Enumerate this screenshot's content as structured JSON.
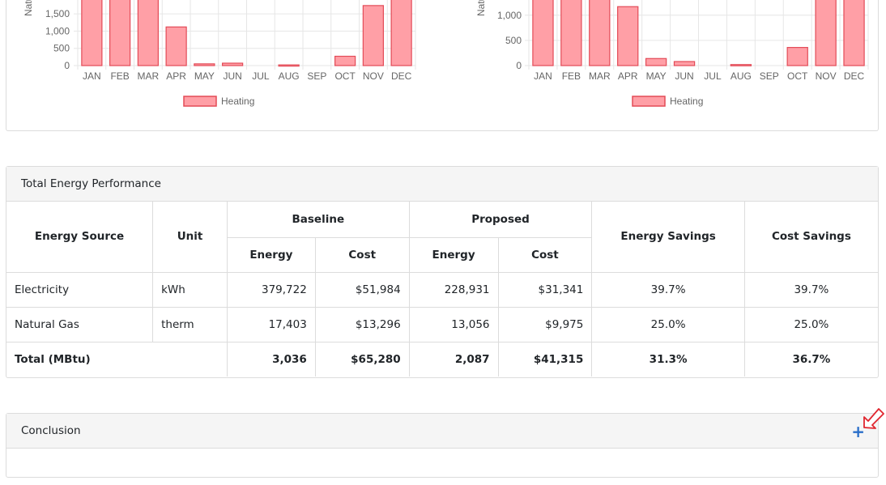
{
  "charts": [
    {
      "ylabel": "Natu",
      "yticks": [
        "1,500",
        "1,000",
        "500",
        "0"
      ],
      "months": [
        "JAN",
        "FEB",
        "MAR",
        "APR",
        "MAY",
        "JUN",
        "JUL",
        "AUG",
        "SEP",
        "OCT",
        "NOV",
        "DEC"
      ],
      "legend": "Heating",
      "colors": {
        "fill": "#ff9fa6",
        "stroke": "#e34b57",
        "grid": "#e6e6e6",
        "text": "#666666"
      }
    },
    {
      "ylabel": "Natu",
      "yticks": [
        "1,000",
        "500",
        "0"
      ],
      "months": [
        "JAN",
        "FEB",
        "MAR",
        "APR",
        "MAY",
        "JUN",
        "JUL",
        "AUG",
        "SEP",
        "OCT",
        "NOV",
        "DEC"
      ],
      "legend": "Heating",
      "colors": {
        "fill": "#ff9fa6",
        "stroke": "#e34b57",
        "grid": "#e6e6e6",
        "text": "#666666"
      }
    }
  ],
  "chart_data": [
    {
      "type": "bar",
      "categories": [
        "JAN",
        "FEB",
        "MAR",
        "APR",
        "MAY",
        "JUN",
        "JUL",
        "AUG",
        "SEP",
        "OCT",
        "NOV",
        "DEC"
      ],
      "series": [
        {
          "name": "Heating",
          "values": [
            2400,
            2300,
            2200,
            1120,
            50,
            70,
            0,
            20,
            0,
            270,
            1740,
            2500
          ]
        }
      ],
      "ylabel": "Natu",
      "yticks": [
        0,
        500,
        1000,
        1500
      ],
      "ylim": [
        0,
        2000
      ],
      "grid": true,
      "legend": "bottom"
    },
    {
      "type": "bar",
      "categories": [
        "JAN",
        "FEB",
        "MAR",
        "APR",
        "MAY",
        "JUN",
        "JUL",
        "AUG",
        "SEP",
        "OCT",
        "NOV",
        "DEC"
      ],
      "series": [
        {
          "name": "Heating",
          "values": [
            1700,
            1650,
            1600,
            1170,
            140,
            80,
            0,
            20,
            0,
            360,
            1500,
            1750
          ]
        }
      ],
      "ylabel": "Natu",
      "yticks": [
        0,
        500,
        1000
      ],
      "ylim": [
        0,
        1200
      ],
      "grid": true,
      "legend": "bottom"
    }
  ],
  "performance": {
    "title": "Total Energy Performance",
    "headers": {
      "source": "Energy Source",
      "unit": "Unit",
      "baseline": "Baseline",
      "proposed": "Proposed",
      "energy": "Energy",
      "cost": "Cost",
      "energy_savings": "Energy Savings",
      "cost_savings": "Cost Savings"
    },
    "rows": [
      {
        "source": "Electricity",
        "unit": "kWh",
        "b_energy": "379,722",
        "b_cost": "$51,984",
        "p_energy": "228,931",
        "p_cost": "$31,341",
        "e_sav": "39.7%",
        "c_sav": "39.7%"
      },
      {
        "source": "Natural Gas",
        "unit": "therm",
        "b_energy": "17,403",
        "b_cost": "$13,296",
        "p_energy": "13,056",
        "p_cost": "$9,975",
        "e_sav": "25.0%",
        "c_sav": "25.0%"
      }
    ],
    "total": {
      "label": "Total (MBtu)",
      "b_energy": "3,036",
      "b_cost": "$65,280",
      "p_energy": "2,087",
      "p_cost": "$41,315",
      "e_sav": "31.3%",
      "c_sav": "36.7%"
    }
  },
  "conclusion": {
    "title": "Conclusion",
    "expand_icon": "plus-icon",
    "expand_symbol": "+",
    "pointer_icon": "pointer-arrow-icon"
  }
}
